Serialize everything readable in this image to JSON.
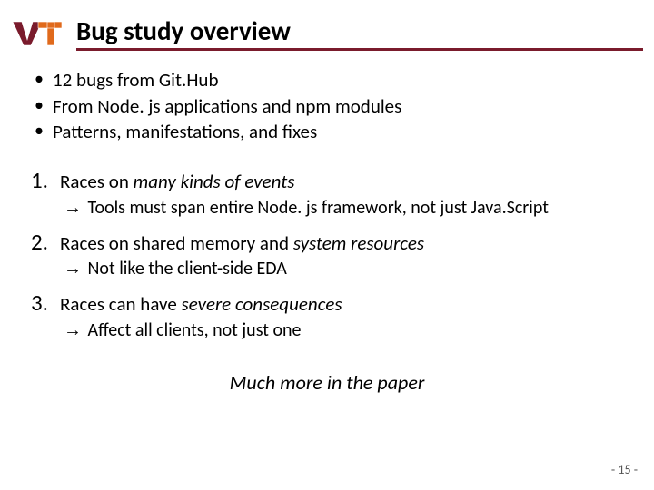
{
  "title": "Bug study overview",
  "bullets": [
    "12 bugs from Git.Hub",
    "From Node. js applications and npm modules",
    "Patterns, manifestations, and fixes"
  ],
  "items": [
    {
      "num": "1.",
      "prefix": "Races on ",
      "em": "many kinds of events",
      "suffix": "",
      "arrow": "→",
      "note": " Tools must span entire Node. js framework, not just Java.Script"
    },
    {
      "num": "2.",
      "prefix": "Races on shared memory and ",
      "em": "system resources",
      "suffix": "",
      "arrow": "→",
      "note": " Not like the client-side EDA"
    },
    {
      "num": "3.",
      "prefix": "Races can have ",
      "em": "severe consequences",
      "suffix": "",
      "arrow": "→",
      "note": " Affect all clients, not just one"
    }
  ],
  "closing": "Much more in the paper",
  "page": "- 15 -"
}
